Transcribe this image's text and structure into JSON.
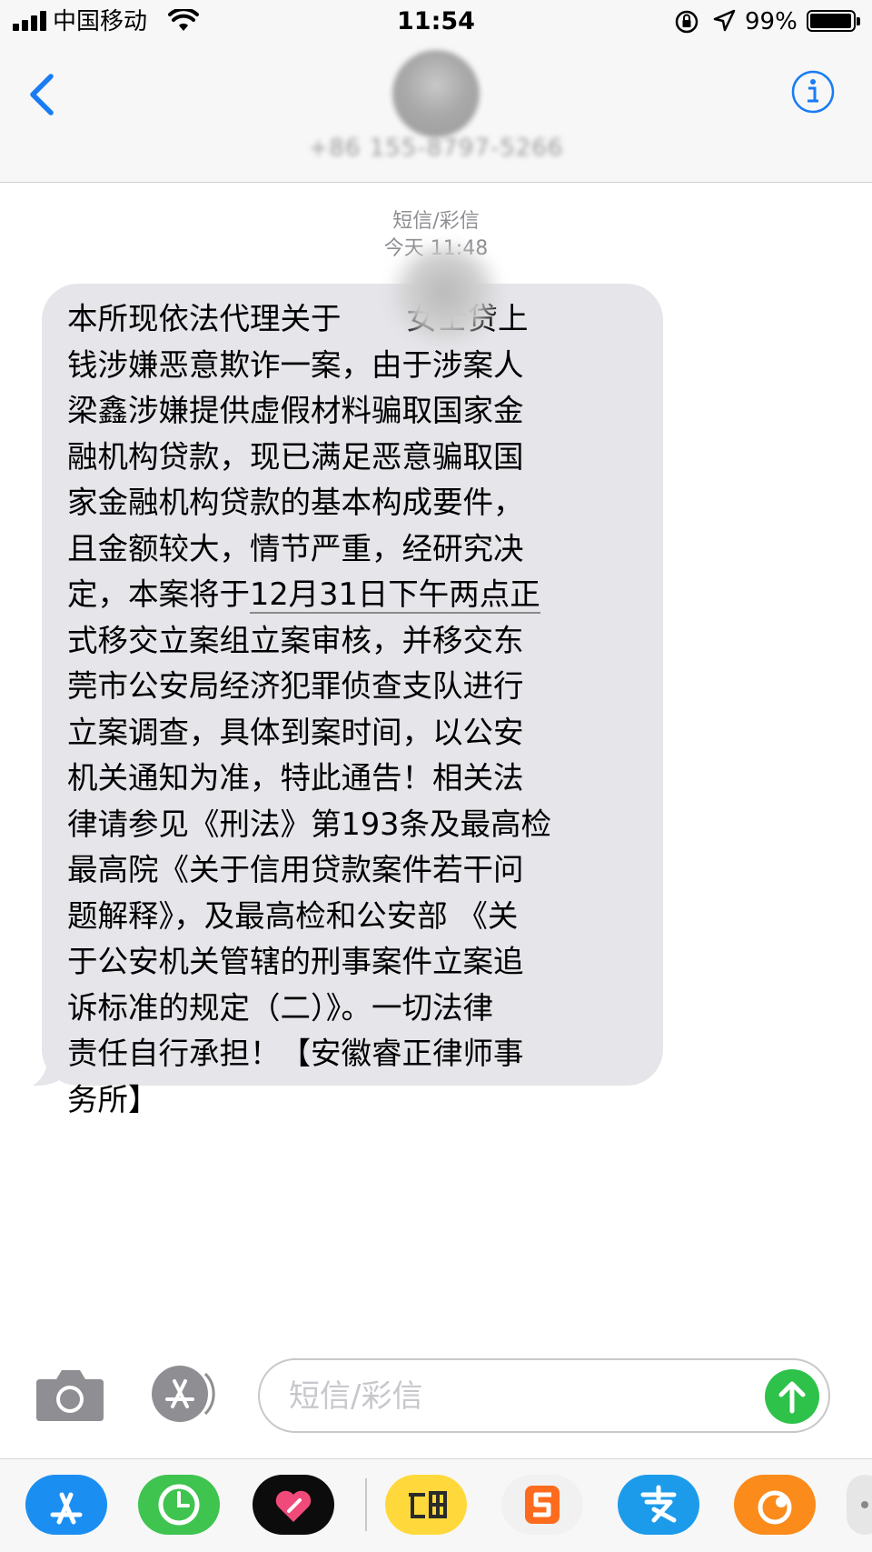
{
  "status_bar": {
    "carrier": "中国移动",
    "time": "11:54",
    "battery": "99%"
  },
  "header": {
    "contact_number": "+86 155-8797-5266",
    "back_icon": "chevron-left-icon",
    "info_icon": "info-icon"
  },
  "message": {
    "type_label": "短信/彩信",
    "timestamp": "今天 11:48",
    "lines": [
      "本所现依法代理关于",
      "女士贷上",
      "钱涉嫌恶意欺诈一案，由于涉案人",
      "梁鑫涉嫌提供虚假材料骗取国家金",
      "融机构贷款，现已满足恶意骗取国",
      "家金融机构贷款的基本构成要件，",
      "且金额较大，情节严重，经研究决",
      "定，本案将于",
      "12月31日下午两点正",
      "式移交立案组立案审核，并移交东",
      "莞市公安局经济犯罪侦查支队进行",
      "立案调查，具体到案时间，以公安",
      "机关通知为准，特此通告！相关法",
      "律请参见《刑法》第193条及最高检",
      "最高院《关于信用贷款案件若干问",
      "题解释》，及最高检和公安部 《关",
      "于公安机关管辖的刑事案件立案追",
      "诉标准的规定（二）》。一切法律",
      "责任自行承担！【安徽睿正律师事",
      "务所】"
    ]
  },
  "input": {
    "placeholder": "短信/彩信"
  },
  "colors": {
    "ios_blue": "#1a7cf4",
    "bubble_gray": "#e5e5ea",
    "send_green": "#2fc24a"
  }
}
